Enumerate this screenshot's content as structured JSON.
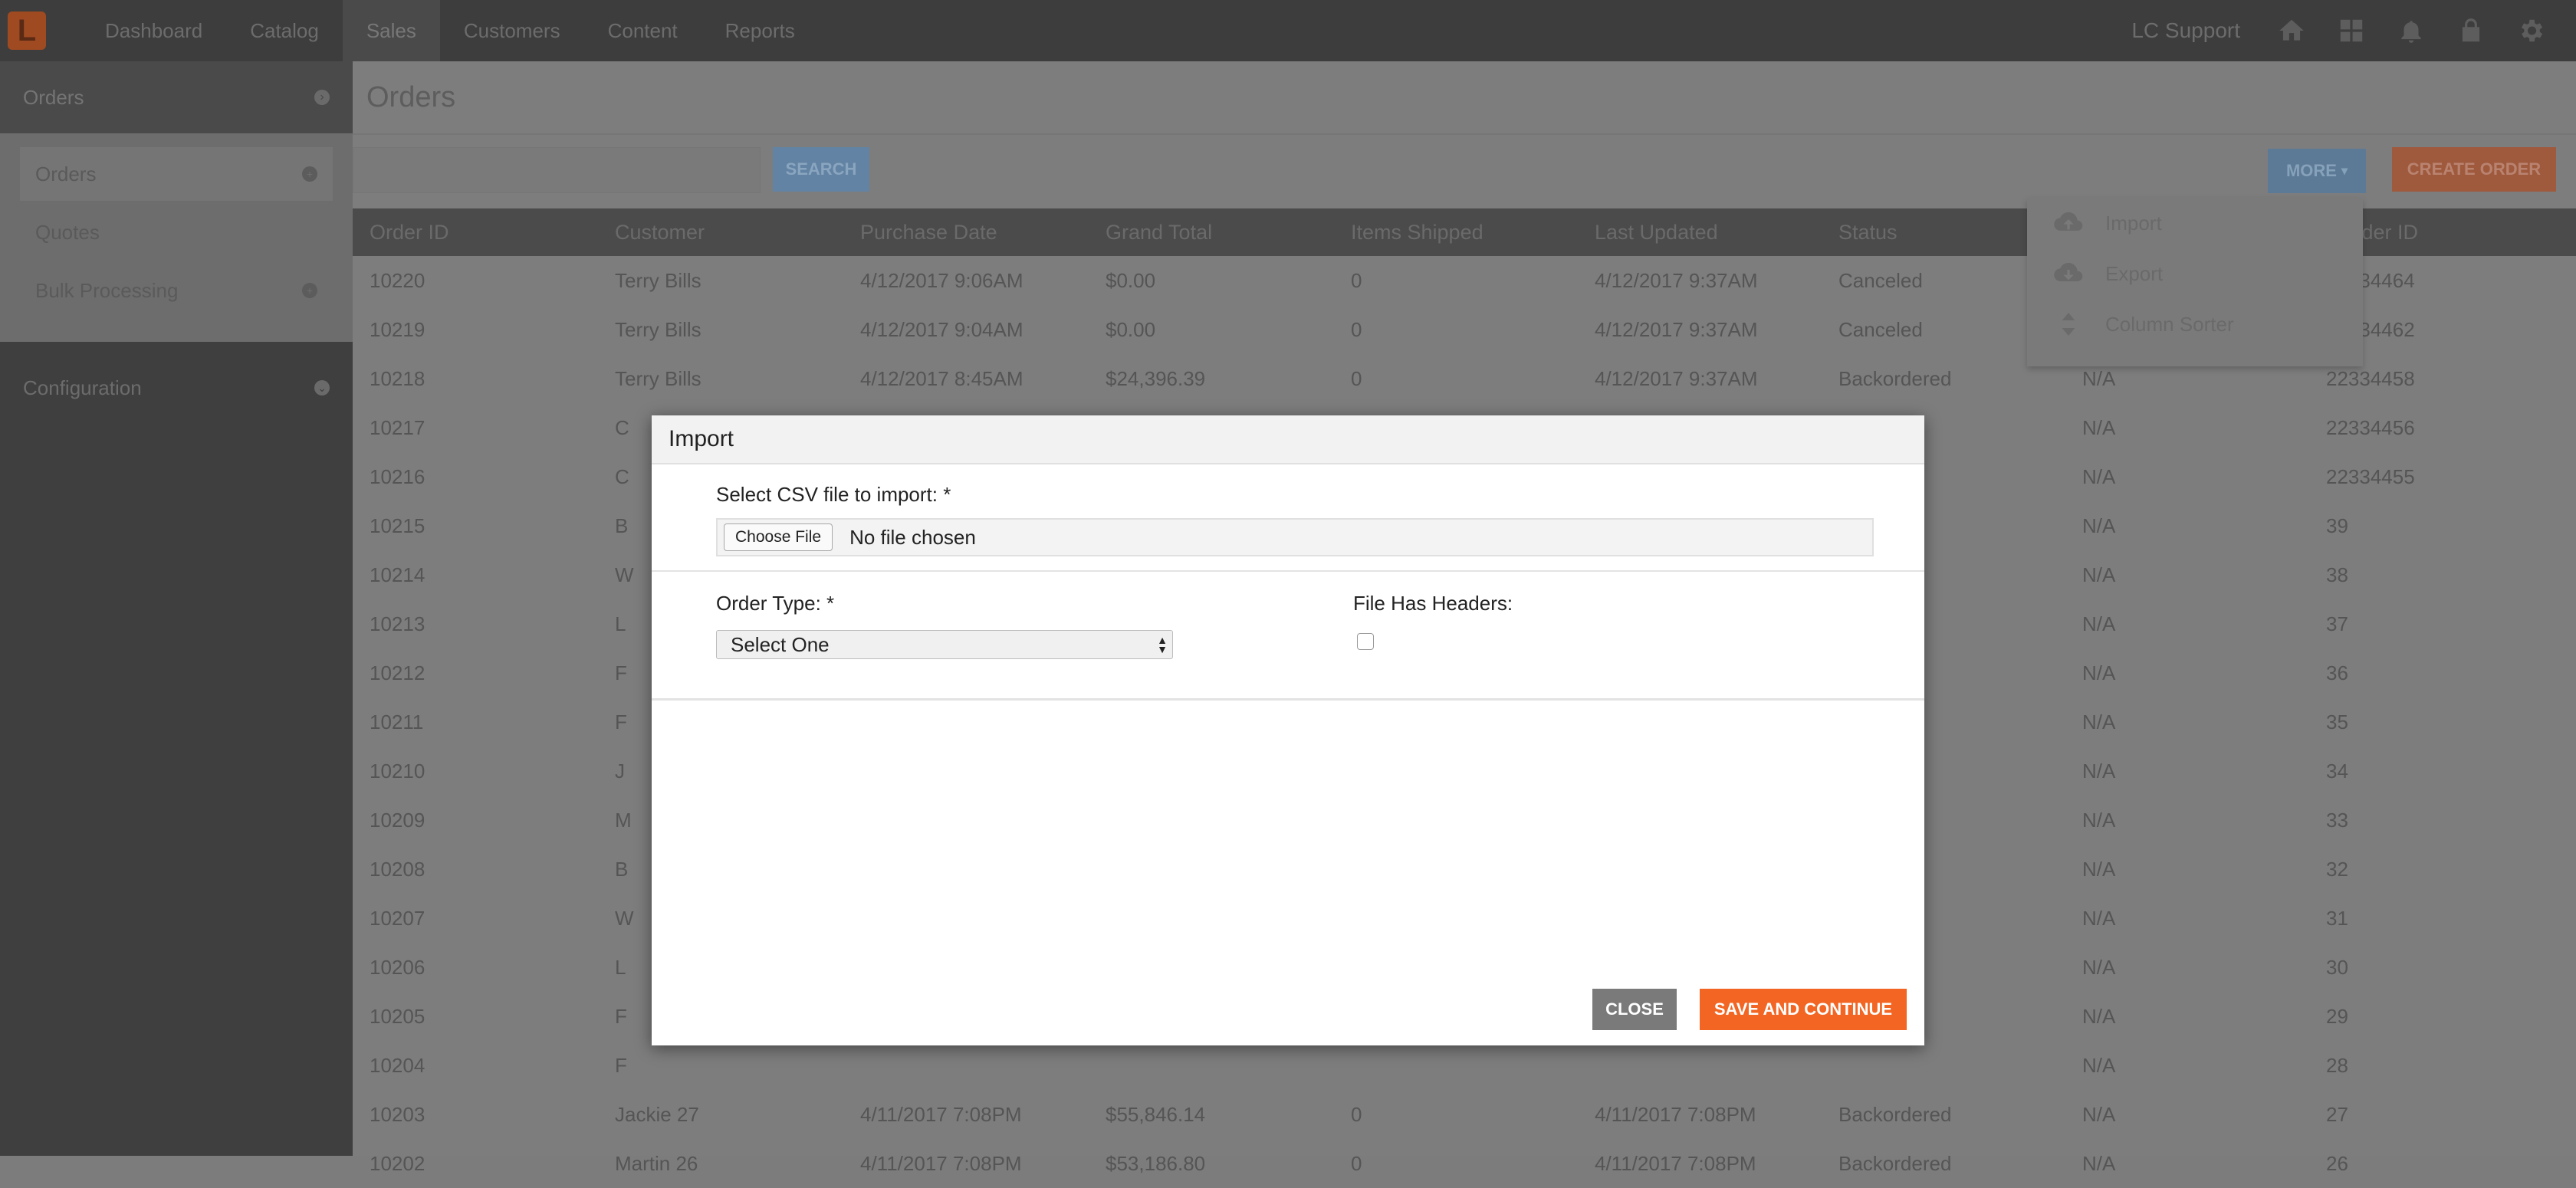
{
  "nav": {
    "logo_letter": "L",
    "items": [
      "Dashboard",
      "Catalog",
      "Sales",
      "Customers",
      "Content",
      "Reports"
    ],
    "active": "Sales",
    "user": "LC Support",
    "icons": [
      "home-icon",
      "grid-icon",
      "bell-icon",
      "lock-icon",
      "gear-icon"
    ]
  },
  "sidebar": {
    "header": "Orders",
    "items": [
      {
        "label": "Orders",
        "has_add": true,
        "active": true
      },
      {
        "label": "Quotes",
        "has_add": false,
        "active": false
      },
      {
        "label": "Bulk Processing",
        "has_add": true,
        "active": false
      }
    ],
    "config_label": "Configuration"
  },
  "main": {
    "title": "Orders",
    "search_label": "SEARCH",
    "more_label": "MORE",
    "create_label": "CREATE ORDER",
    "more_menu": [
      {
        "label": "Import",
        "icon": "cloud-upload-icon"
      },
      {
        "label": "Export",
        "icon": "cloud-download-icon"
      },
      {
        "label": "Column Sorter",
        "icon": "sort-icon"
      }
    ]
  },
  "table": {
    "columns": [
      "Order ID",
      "Customer",
      "Purchase Date",
      "Grand Total",
      "Items Shipped",
      "Last Updated",
      "Status",
      "",
      "r Order ID"
    ],
    "rows": [
      [
        "10220",
        "Terry Bills",
        "4/12/2017 9:06AM",
        "$0.00",
        "0",
        "4/12/2017 9:37AM",
        "Canceled",
        "",
        "22334464"
      ],
      [
        "10219",
        "Terry Bills",
        "4/12/2017 9:04AM",
        "$0.00",
        "0",
        "4/12/2017 9:37AM",
        "Canceled",
        "",
        "22334462"
      ],
      [
        "10218",
        "Terry Bills",
        "4/12/2017 8:45AM",
        "$24,396.39",
        "0",
        "4/12/2017 9:37AM",
        "Backordered",
        "N/A",
        "22334458"
      ],
      [
        "10217",
        "C",
        "",
        "",
        "",
        "",
        "",
        "N/A",
        "22334456"
      ],
      [
        "10216",
        "C",
        "",
        "",
        "",
        "",
        "",
        "N/A",
        "22334455"
      ],
      [
        "10215",
        "B",
        "",
        "",
        "",
        "",
        "",
        "N/A",
        "39"
      ],
      [
        "10214",
        "W",
        "",
        "",
        "",
        "",
        "",
        "N/A",
        "38"
      ],
      [
        "10213",
        "L",
        "",
        "",
        "",
        "",
        "",
        "N/A",
        "37"
      ],
      [
        "10212",
        "F",
        "",
        "",
        "",
        "",
        "",
        "N/A",
        "36"
      ],
      [
        "10211",
        "F",
        "",
        "",
        "",
        "",
        "",
        "N/A",
        "35"
      ],
      [
        "10210",
        "J",
        "",
        "",
        "",
        "",
        "",
        "N/A",
        "34"
      ],
      [
        "10209",
        "M",
        "",
        "",
        "",
        "",
        "",
        "N/A",
        "33"
      ],
      [
        "10208",
        "B",
        "",
        "",
        "",
        "",
        "",
        "N/A",
        "32"
      ],
      [
        "10207",
        "W",
        "",
        "",
        "",
        "",
        "",
        "N/A",
        "31"
      ],
      [
        "10206",
        "L",
        "",
        "",
        "",
        "",
        "",
        "N/A",
        "30"
      ],
      [
        "10205",
        "F",
        "",
        "",
        "",
        "",
        "",
        "N/A",
        "29"
      ],
      [
        "10204",
        "F",
        "",
        "",
        "",
        "",
        "",
        "N/A",
        "28"
      ],
      [
        "10203",
        "Jackie 27",
        "4/11/2017 7:08PM",
        "$55,846.14",
        "0",
        "4/11/2017 7:08PM",
        "Backordered",
        "N/A",
        "27"
      ],
      [
        "10202",
        "Martin 26",
        "4/11/2017 7:08PM",
        "$53,186.80",
        "0",
        "4/11/2017 7:08PM",
        "Backordered",
        "N/A",
        "26"
      ]
    ]
  },
  "modal": {
    "title": "Import",
    "csv_label": "Select CSV file to import: *",
    "choose_file": "Choose File",
    "no_file": "No file chosen",
    "order_type_label": "Order Type: *",
    "order_type_value": "Select One",
    "headers_label": "File Has Headers:",
    "headers_checked": false,
    "close_label": "CLOSE",
    "save_label": "SAVE AND CONTINUE"
  },
  "colors": {
    "accent_orange": "#f26522",
    "close_gray": "#7a7a7a",
    "overlay": "#7c7c7c"
  }
}
